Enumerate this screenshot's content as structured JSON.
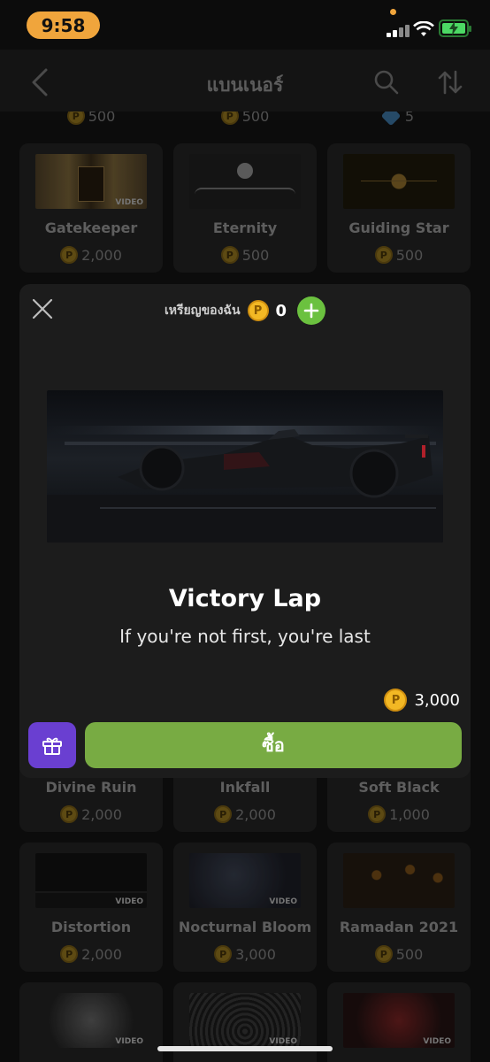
{
  "status_bar": {
    "time": "9:58"
  },
  "nav": {
    "title": "แบนเนอร์",
    "back_icon": "chevron-left-icon",
    "search_icon": "search-icon",
    "sort_icon": "sort-icon"
  },
  "top_prices": [
    {
      "price": "500",
      "currency": "coin"
    },
    {
      "price": "500",
      "currency": "coin"
    },
    {
      "price": "5",
      "currency": "gem"
    }
  ],
  "banners": [
    {
      "name": "Gatekeeper",
      "price": "2,000",
      "video": true
    },
    {
      "name": "Eternity",
      "price": "500",
      "video": false
    },
    {
      "name": "Guiding Star",
      "price": "500",
      "video": false
    },
    {
      "name": "Divine Ruin",
      "price": "2,000",
      "video": false
    },
    {
      "name": "Inkfall",
      "price": "2,000",
      "video": false
    },
    {
      "name": "Soft Black",
      "price": "1,000",
      "video": false
    },
    {
      "name": "Distortion",
      "price": "2,000",
      "video": true
    },
    {
      "name": "Nocturnal Bloom",
      "price": "3,000",
      "video": true
    },
    {
      "name": "Ramadan 2021",
      "price": "500",
      "video": false
    }
  ],
  "video_tag": "VIDEO",
  "coin_letter": "P",
  "modal": {
    "wallet_label": "เหรียญของฉัน",
    "wallet_count": "0",
    "banner_name": "Victory Lap",
    "banner_desc": "If you're not first, you're last",
    "price": "3,000",
    "buy_label": "ซื้อ"
  },
  "colors": {
    "accent_green": "#78ab43",
    "gift_purple": "#6a3fd1",
    "coin_gold": "#f3b824",
    "time_pill": "#f0a53c"
  }
}
